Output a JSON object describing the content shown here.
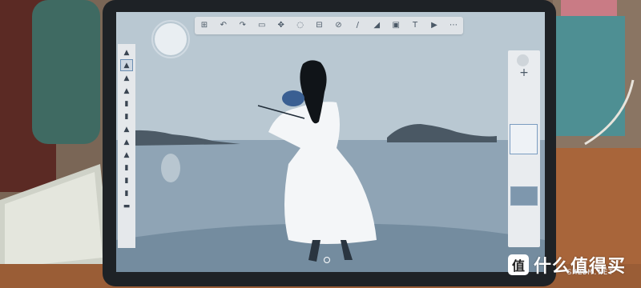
{
  "app": {
    "name": "sketch-drawing-app"
  },
  "colors": {
    "sky": "#b9c8d2",
    "sea": "#8fa4b5",
    "shore": "#748c9f",
    "toolbar_bg": "#dfe3e7",
    "accent": "#6c8fb3",
    "wall": "#6d5a4a"
  },
  "top_toolbar": {
    "icons": [
      "grid-icon",
      "undo-icon",
      "redo-icon",
      "select-icon",
      "move-icon",
      "lasso-icon",
      "ruler-icon",
      "symmetry-icon",
      "brush-icon",
      "fill-icon",
      "image-icon",
      "text-icon",
      "video-icon",
      "more-icon"
    ],
    "labels": [
      "⊞",
      "↶",
      "↷",
      "▭",
      "✥",
      "◌",
      "⊟",
      "⊘",
      "/",
      "◢",
      "▣",
      "T",
      "▶",
      "⋯"
    ]
  },
  "left_toolbar": {
    "brushes": [
      "pencil-brush",
      "ballpoint-brush",
      "marker-brush",
      "airbrush-brush",
      "paintbrush-brush",
      "pen-brush",
      "calligraphy-brush",
      "felt-brush",
      "smudge-brush",
      "eraser-brush",
      "fill-brush",
      "blender-brush",
      "texture-brush"
    ],
    "glyphs": [
      "▲",
      "▲",
      "▲",
      "▲",
      "▮",
      "▮",
      "▲",
      "▲",
      "▲",
      "▮",
      "▮",
      "▮",
      "▬"
    ],
    "active_index": 1
  },
  "right_panel": {
    "add_label": "+"
  },
  "watermark": {
    "badge": "值",
    "text": "什么值得买",
    "site": "SMZDM.NET"
  }
}
